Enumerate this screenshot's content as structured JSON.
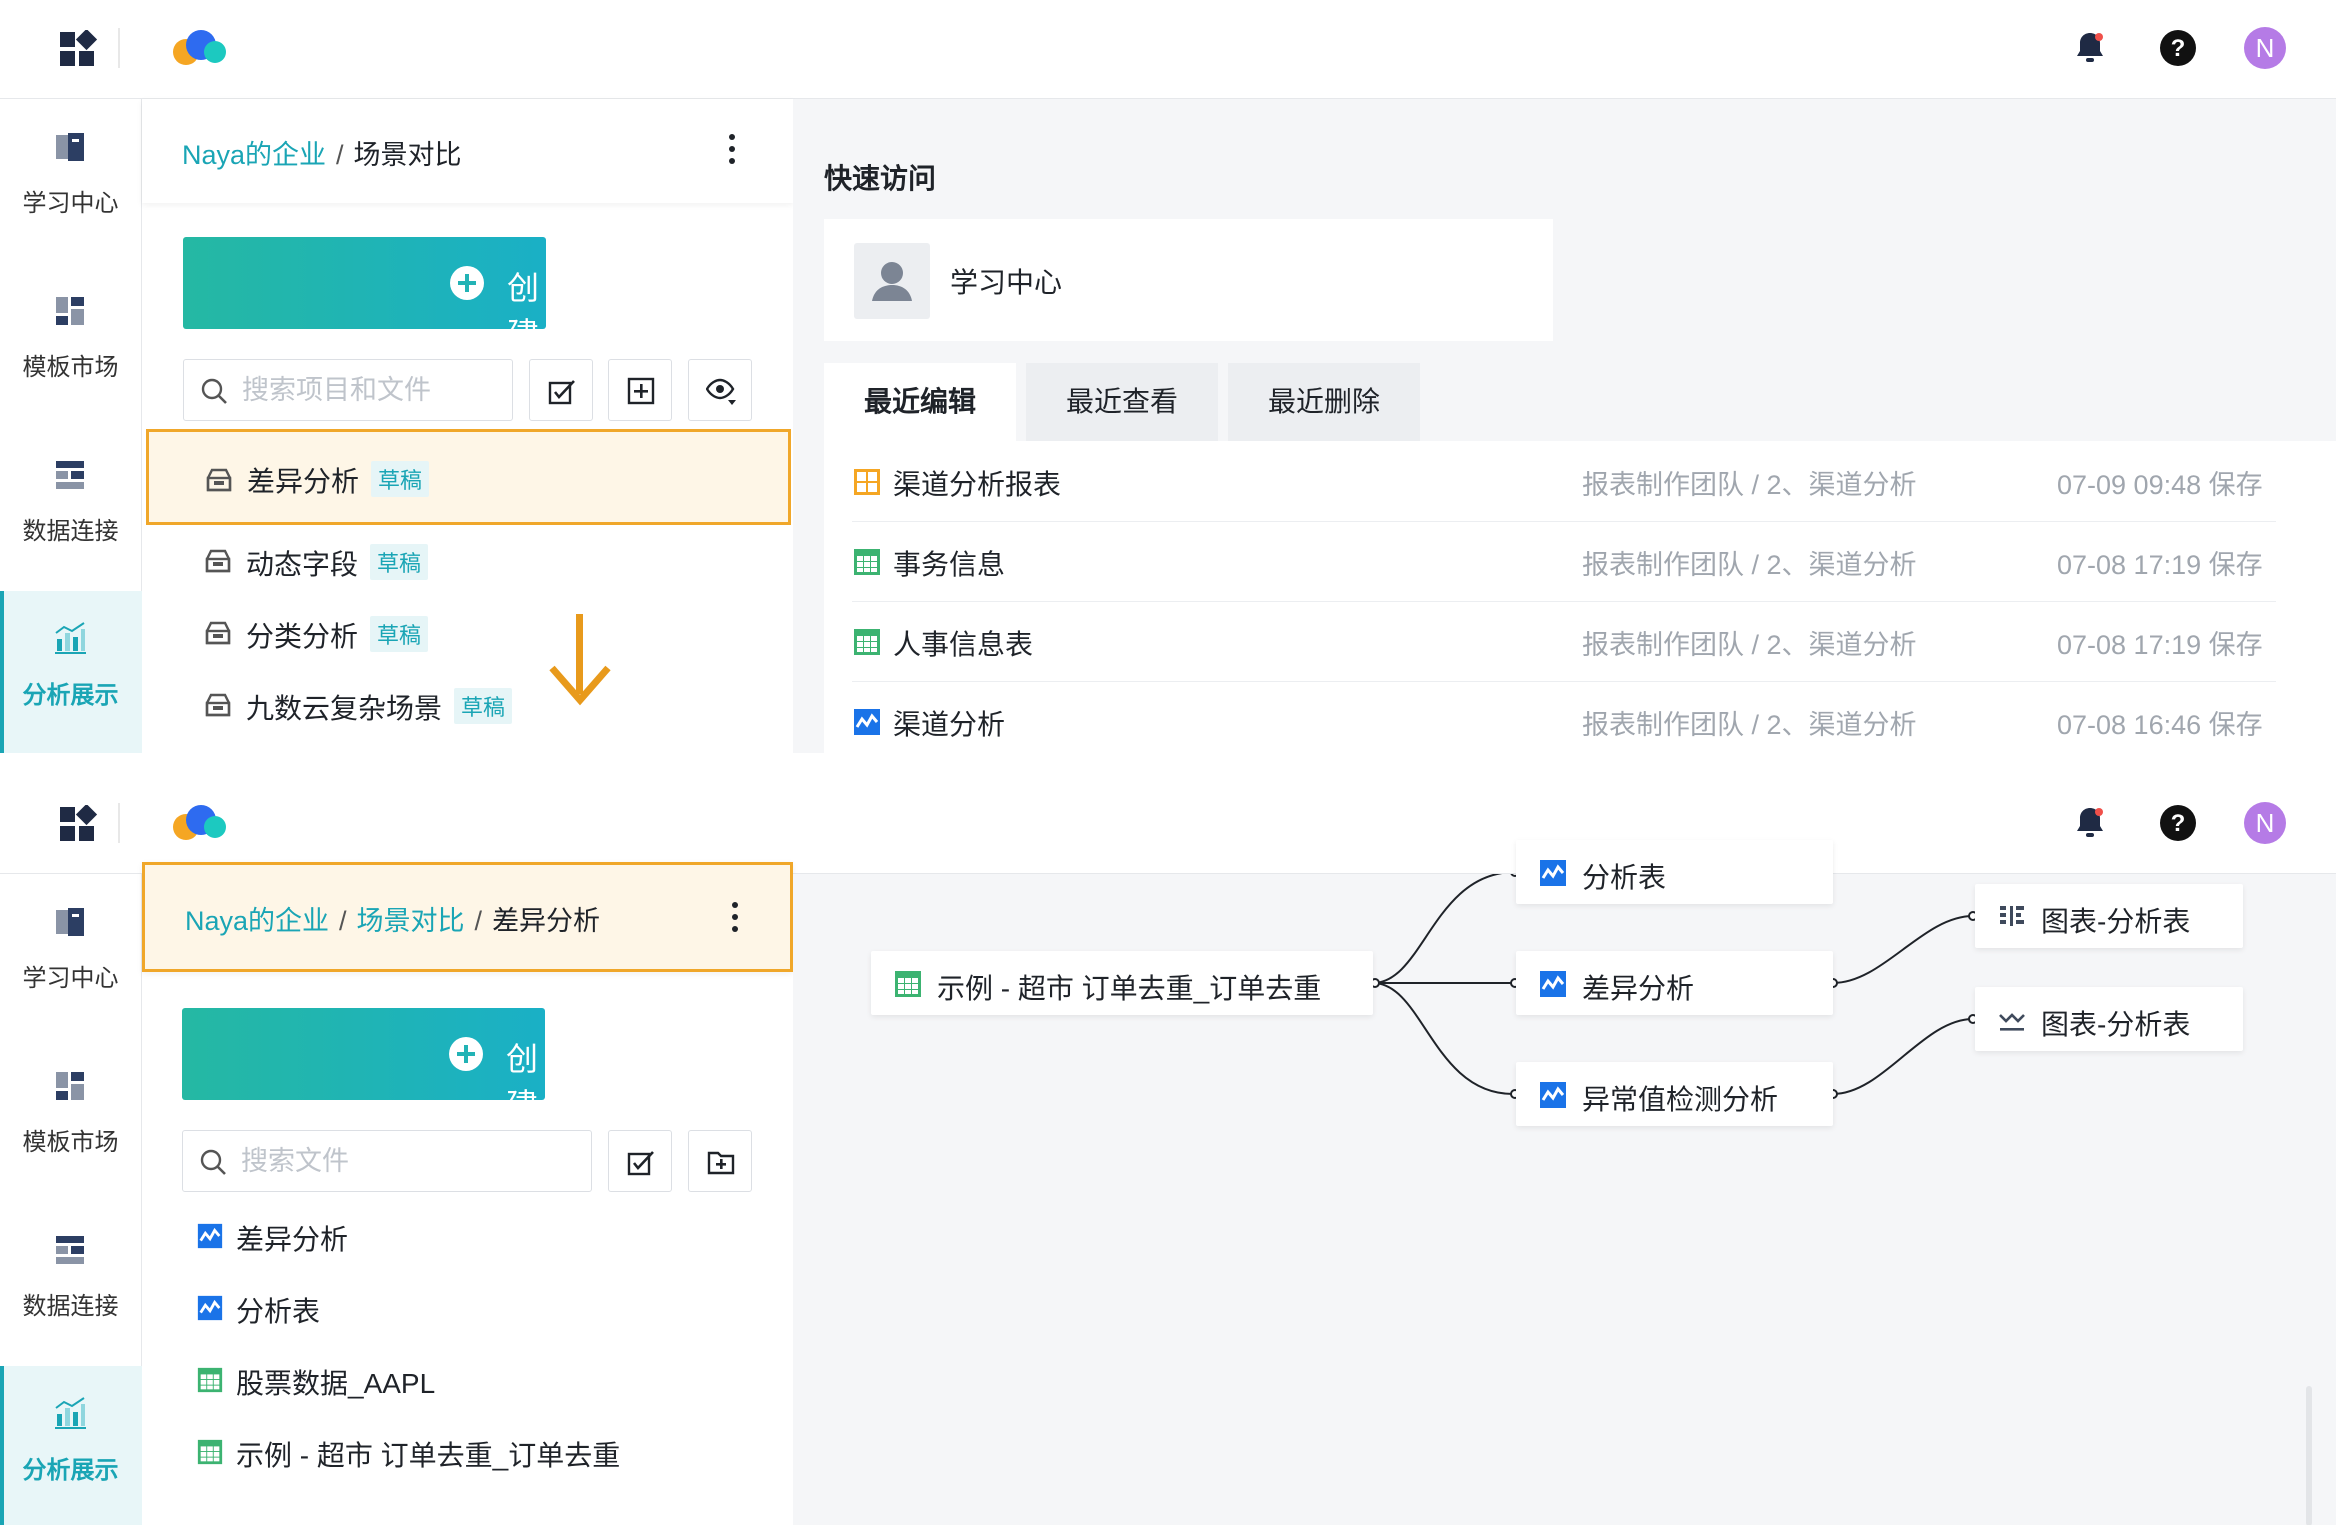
{
  "topbar": {
    "avatar_letter": "N"
  },
  "leftnav": {
    "items": [
      {
        "label": "学习中心",
        "icon": "book-icon"
      },
      {
        "label": "模板市场",
        "icon": "template-icon"
      },
      {
        "label": "数据连接",
        "icon": "data-connection-icon"
      },
      {
        "label": "分析展示",
        "icon": "chart-icon",
        "active": true
      }
    ]
  },
  "panel1": {
    "breadcrumb": {
      "root": "Naya的企业",
      "sep": "/",
      "current": "场景对比"
    },
    "create_label": "创建",
    "search_placeholder": "搜索项目和文件",
    "tree_items": [
      {
        "label": "差异分析",
        "tag": "草稿",
        "highlighted": true
      },
      {
        "label": "动态字段",
        "tag": "草稿"
      },
      {
        "label": "分类分析",
        "tag": "草稿"
      },
      {
        "label": "九数云复杂场景",
        "tag": "草稿"
      }
    ],
    "quick_access": {
      "title": "快速访问",
      "card_label": "学习中心"
    },
    "tabs": [
      {
        "label": "最近编辑",
        "active": true
      },
      {
        "label": "最近查看"
      },
      {
        "label": "最近删除"
      }
    ],
    "recent": [
      {
        "name": "渠道分析报表",
        "path": "报表制作团队 / 2、渠道分析",
        "time": "07-09 09:48 保存",
        "type": "report"
      },
      {
        "name": "事务信息",
        "path": "报表制作团队 / 2、渠道分析",
        "time": "07-08 17:19 保存",
        "type": "table"
      },
      {
        "name": "人事信息表",
        "path": "报表制作团队 / 2、渠道分析",
        "time": "07-08 17:19 保存",
        "type": "table"
      },
      {
        "name": "渠道分析",
        "path": "报表制作团队 / 2、渠道分析",
        "time": "07-08 16:46 保存",
        "type": "analysis"
      }
    ]
  },
  "panel2": {
    "breadcrumb": {
      "root": "Naya的企业",
      "sep": "/",
      "middle": "场景对比",
      "current": "差异分析"
    },
    "create_label": "创建",
    "search_placeholder": "搜索文件",
    "tree_items": [
      {
        "label": "差异分析",
        "type": "analysis"
      },
      {
        "label": "分析表",
        "type": "analysis"
      },
      {
        "label": "股票数据_AAPL",
        "type": "table"
      },
      {
        "label": "示例 - 超市 订单去重_订单去重",
        "type": "table"
      }
    ],
    "lineage": {
      "source": "示例 - 超市 订单去重_订单去重",
      "mid": [
        "分析表",
        "差异分析",
        "异常值检测分析"
      ],
      "out": [
        "图表-分析表",
        "图表-分析表"
      ]
    }
  },
  "colors": {
    "accent": "#1aa5b5",
    "highlight": "#f0a72a",
    "draft_bg": "#e6f5f7"
  }
}
